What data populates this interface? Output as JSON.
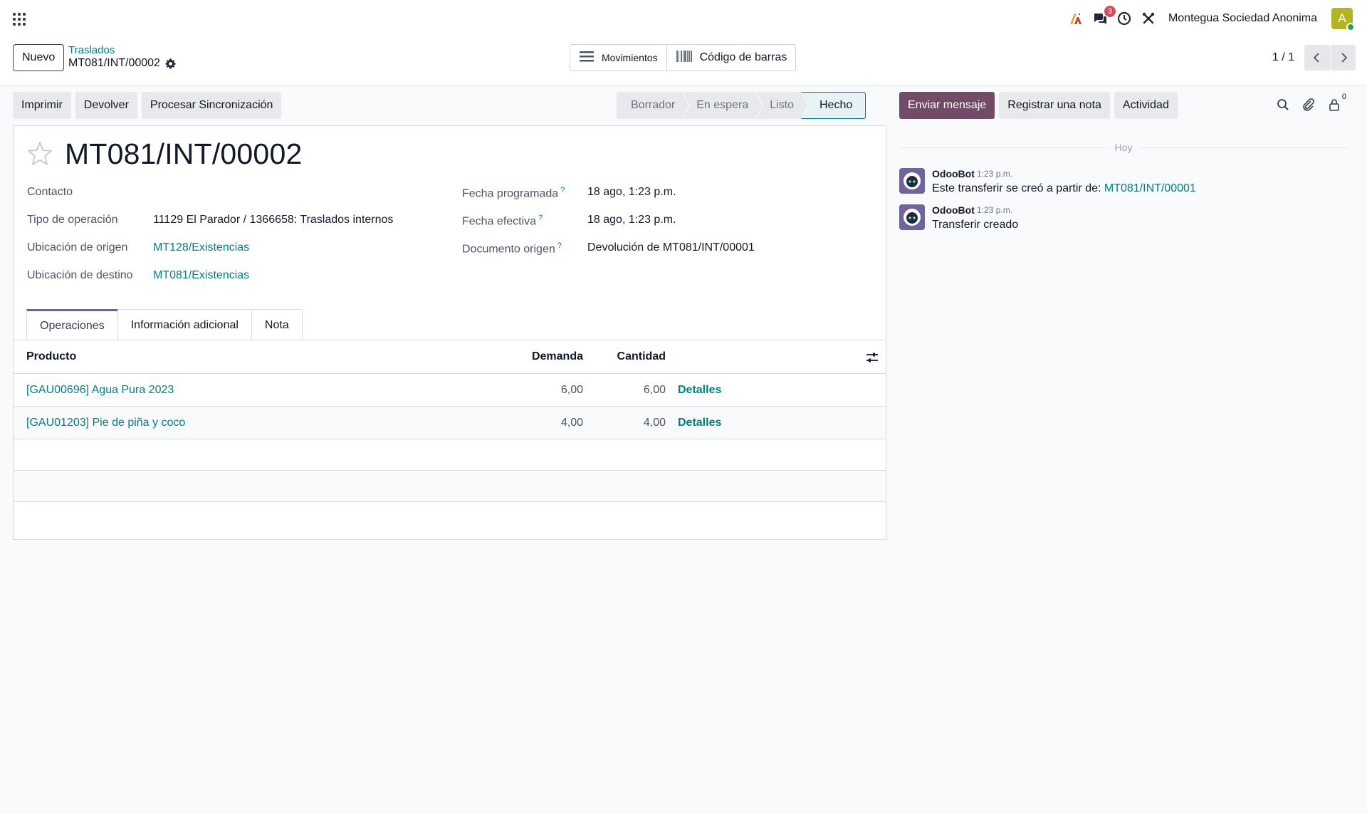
{
  "navbar": {
    "messages_badge": "3",
    "company": "Montegua Sociedad Anonima",
    "avatar_letter": "A",
    "avatar_color": "#b3b520"
  },
  "control_panel": {
    "new_button": "Nuevo",
    "breadcrumb_parent": "Traslados",
    "breadcrumb_current": "MT081/INT/00002",
    "smart_buttons": {
      "moves": "Movimientos",
      "barcode": "Código de barras"
    },
    "pager": "1 / 1"
  },
  "actions": {
    "print": "Imprimir",
    "return": "Devolver",
    "sync": "Procesar Sincronización"
  },
  "statusbar": {
    "steps": [
      "Borrador",
      "En espera",
      "Listo",
      "Hecho"
    ],
    "active": "Hecho"
  },
  "record": {
    "title": "MT081/INT/00002",
    "left_fields": {
      "contact_label": "Contacto",
      "contact_value": "",
      "op_type_label": "Tipo de operación",
      "op_type_value": "11129 El Parador / 1366658: Traslados internos",
      "src_label": "Ubicación de origen",
      "src_value": "MT128/Existencias",
      "dest_label": "Ubicación de destino",
      "dest_value": "MT081/Existencias"
    },
    "right_fields": {
      "scheduled_label": "Fecha programada",
      "scheduled_value": "18 ago, 1:23 p.m.",
      "effective_label": "Fecha efectiva",
      "effective_value": "18 ago, 1:23 p.m.",
      "origin_label": "Documento origen",
      "origin_value": "Devolución de MT081/INT/00001",
      "help_mark": "?"
    }
  },
  "tabs": [
    "Operaciones",
    "Información adicional",
    "Nota"
  ],
  "table": {
    "headers": {
      "product": "Producto",
      "demand": "Demanda",
      "quantity": "Cantidad"
    },
    "rows": [
      {
        "product": "[GAU00696] Agua Pura 2023",
        "demand": "6,00",
        "quantity": "6,00",
        "details": "Detalles"
      },
      {
        "product": "[GAU01203] Pie de piña y coco",
        "demand": "4,00",
        "quantity": "4,00",
        "details": "Detalles"
      }
    ]
  },
  "chatter": {
    "send_message": "Enviar mensaje",
    "log_note": "Registrar una nota",
    "activity": "Actividad",
    "followers_count": "0",
    "day_separator": "Hoy",
    "messages": [
      {
        "author": "OdooBot",
        "time": "1:23 p.m.",
        "text": "Este transferir se creó a partir de: ",
        "link": "MT081/INT/00001"
      },
      {
        "author": "OdooBot",
        "time": "1:23 p.m.",
        "text": "Transferir creado",
        "link": ""
      }
    ]
  },
  "colors": {
    "primary": "#714b67",
    "link": "#017e84",
    "tab_accent": "#71639e"
  }
}
